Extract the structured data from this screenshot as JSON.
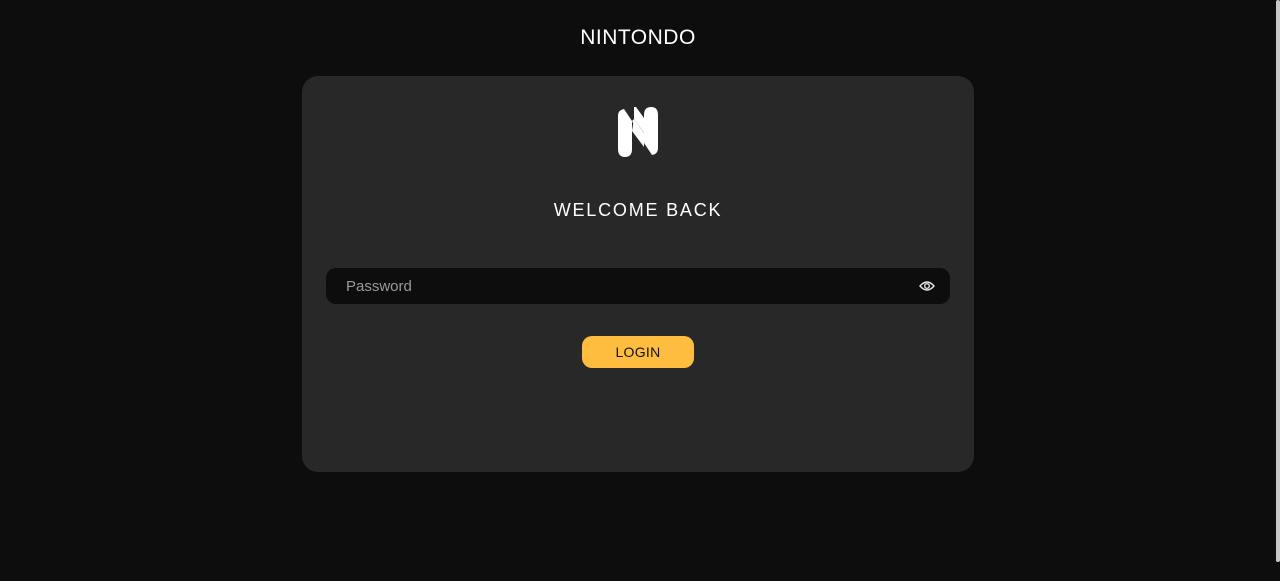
{
  "header": {
    "brand": "NINTONDO"
  },
  "card": {
    "logo_icon": "nintondo-logo-icon",
    "title": "WELCOME BACK",
    "password": {
      "placeholder": "Password",
      "value": "",
      "toggle_icon": "eye-icon"
    },
    "login_label": "LOGIN"
  },
  "colors": {
    "background": "#0d0d0d",
    "card": "#282828",
    "input": "#0d0d0d",
    "accent": "#ffbd3f",
    "text": "#ffffff",
    "placeholder": "#9a9a9a"
  }
}
